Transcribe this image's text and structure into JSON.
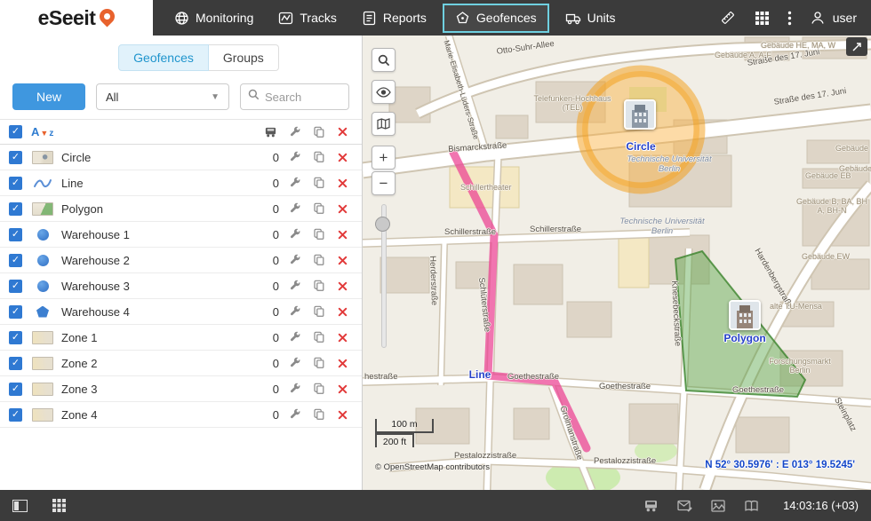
{
  "header": {
    "logo": "eSeeit",
    "nav": [
      {
        "label": "Monitoring"
      },
      {
        "label": "Tracks"
      },
      {
        "label": "Reports"
      },
      {
        "label": "Geofences"
      },
      {
        "label": "Units"
      }
    ],
    "user_label": "user"
  },
  "sidebar": {
    "tabs": {
      "geofences": "Geofences",
      "groups": "Groups"
    },
    "new_button": "New",
    "filter_value": "All",
    "search_placeholder": "Search",
    "rows": [
      {
        "name": "Circle",
        "count": "0"
      },
      {
        "name": "Line",
        "count": "0"
      },
      {
        "name": "Polygon",
        "count": "0"
      },
      {
        "name": "Warehouse 1",
        "count": "0"
      },
      {
        "name": "Warehouse 2",
        "count": "0"
      },
      {
        "name": "Warehouse 3",
        "count": "0"
      },
      {
        "name": "Warehouse 4",
        "count": "0"
      },
      {
        "name": "Zone 1",
        "count": "0"
      },
      {
        "name": "Zone 2",
        "count": "0"
      },
      {
        "name": "Zone 3",
        "count": "0"
      },
      {
        "name": "Zone 4",
        "count": "0"
      }
    ]
  },
  "map": {
    "geofence_labels": {
      "circle": "Circle",
      "line": "Line",
      "polygon": "Polygon"
    },
    "zoom_in": "+",
    "zoom_out": "−",
    "scale": {
      "metric": "100 m",
      "imperial": "200 ft"
    },
    "attribution": "© OpenStreetMap contributors",
    "coordinates": "N 52° 30.5976' : E 013° 19.5245'",
    "streets": {
      "otto": "Otto-Suhr-Allee",
      "s17a": "Straße des 17. Juni",
      "s17b": "Straße des 17. Juni",
      "bismarck": "Bismarckstraße",
      "marie": "Marie-Elisabeth-Lüders-Straße",
      "schiller1": "Schillerstraße",
      "schiller2": "Schillerstraße",
      "herder": "Herderstraße",
      "schlueter": "Schlüterstraße",
      "goethe_cut": "hestraße",
      "goethe2": "Goethestraße",
      "goethe3": "Goethestraße",
      "goethe4": "Goethestraße",
      "pestalozzi1": "Pestalozzistraße",
      "pestalozzi2": "Pestalozzistraße",
      "knesebeck": "Knesebeckstraße",
      "hardenberg": "Hardenbergstraße",
      "grolman": "Grolmanstraße",
      "steinplatz": "Steinplatz"
    },
    "places": {
      "geb_hemaw": "Gebäude HE, MA, W",
      "geb_aaf": "Gebäude A, A-F",
      "geb1": "Gebäude",
      "geb2": "Gebäude",
      "geb_eb": "Gebäude EB",
      "geb_b": "Gebäude B, BA, BH A, BH-N",
      "geb_ew": "Gebäude EW",
      "mensa": "alte TU-Mensa",
      "telefunken": "Telefunken-Hochhaus (TEL)",
      "tu1": "Technische Universität Berlin",
      "tu2": "Technische Universität Berlin",
      "theater": "Schillertheater",
      "forschung": "Forschungsmarkt Berlin"
    }
  },
  "statusbar": {
    "time": "14:03:16 (+03)"
  }
}
